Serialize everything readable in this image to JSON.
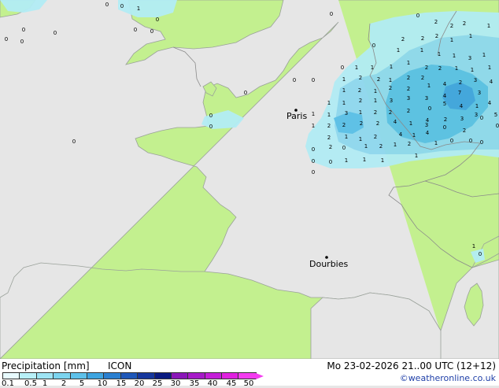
{
  "map": {
    "colors": {
      "sea": "#e6e6e6",
      "land": "#c3f08f",
      "coast": "#9aa19a",
      "border": "#8a8a8a",
      "rain_light": "#b2ecf4",
      "rain_mid": "#8ed8ee",
      "rain_heavy": "#58c0e6"
    },
    "cities": [
      {
        "name": "Paris",
        "dot": [
          376,
          140
        ],
        "label": [
          364,
          151
        ]
      },
      {
        "name": "Dourbies",
        "dot": [
          415,
          327
        ],
        "label": [
          393,
          339
        ]
      }
    ],
    "precip_values": [
      [
        "1",
        176,
        13
      ],
      [
        "0",
        136,
        8
      ],
      [
        "0",
        155,
        10
      ],
      [
        "0",
        30,
        40
      ],
      [
        "0",
        8,
        52
      ],
      [
        "0",
        28,
        55
      ],
      [
        "0",
        70,
        44
      ],
      [
        "0",
        172,
        40
      ],
      [
        "0",
        193,
        42
      ],
      [
        "0",
        200,
        27
      ],
      [
        "0",
        312,
        120
      ],
      [
        "0",
        268,
        149
      ],
      [
        "0",
        268,
        163
      ],
      [
        "0",
        94,
        182
      ],
      [
        "0",
        374,
        104
      ],
      [
        "0",
        398,
        104
      ],
      [
        "0",
        421,
        20
      ],
      [
        "2",
        512,
        52
      ],
      [
        "2",
        537,
        51
      ],
      [
        "2",
        555,
        48
      ],
      [
        "1",
        574,
        53
      ],
      [
        "1",
        598,
        48
      ],
      [
        "2",
        590,
        32
      ],
      [
        "2",
        574,
        35
      ],
      [
        "2",
        554,
        30
      ],
      [
        "0",
        531,
        22
      ],
      [
        "1",
        621,
        35
      ],
      [
        "0",
        475,
        60
      ],
      [
        "1",
        506,
        66
      ],
      [
        "1",
        536,
        66
      ],
      [
        "1",
        558,
        71
      ],
      [
        "1",
        577,
        73
      ],
      [
        "3",
        597,
        76
      ],
      [
        "1",
        519,
        82
      ],
      [
        "1",
        497,
        87
      ],
      [
        "2",
        542,
        88
      ],
      [
        "2",
        559,
        89
      ],
      [
        "1",
        580,
        89
      ],
      [
        "1",
        600,
        91
      ],
      [
        "1",
        622,
        88
      ],
      [
        "1",
        615,
        72
      ],
      [
        "0",
        435,
        88
      ],
      [
        "1",
        453,
        88
      ],
      [
        "1",
        473,
        88
      ],
      [
        "2",
        481,
        103
      ],
      [
        "1",
        496,
        104
      ],
      [
        "2",
        458,
        101
      ],
      [
        "1",
        437,
        103
      ],
      [
        "2",
        519,
        101
      ],
      [
        "2",
        537,
        101
      ],
      [
        "1",
        545,
        111
      ],
      [
        "4",
        565,
        109
      ],
      [
        "2",
        585,
        107
      ],
      [
        "3",
        604,
        104
      ],
      [
        "4",
        624,
        106
      ],
      [
        "1",
        437,
        117
      ],
      [
        "2",
        457,
        117
      ],
      [
        "1",
        477,
        118
      ],
      [
        "2",
        496,
        114
      ],
      [
        "2",
        519,
        115
      ],
      [
        "7",
        584,
        120
      ],
      [
        "4",
        565,
        124
      ],
      [
        "3",
        609,
        120
      ],
      [
        "4",
        622,
        133
      ],
      [
        "3",
        542,
        127
      ],
      [
        "1",
        418,
        133
      ],
      [
        "1",
        437,
        133
      ],
      [
        "2",
        458,
        130
      ],
      [
        "1",
        477,
        130
      ],
      [
        "3",
        497,
        130
      ],
      [
        "3",
        519,
        127
      ],
      [
        "0",
        546,
        140
      ],
      [
        "4",
        586,
        137
      ],
      [
        "1",
        606,
        137
      ],
      [
        "5",
        565,
        134
      ],
      [
        "1",
        398,
        147
      ],
      [
        "1",
        418,
        148
      ],
      [
        "3",
        440,
        146
      ],
      [
        "1",
        458,
        145
      ],
      [
        "2",
        477,
        145
      ],
      [
        "2",
        496,
        145
      ],
      [
        "2",
        519,
        143
      ],
      [
        "4",
        543,
        155
      ],
      [
        "2",
        566,
        154
      ],
      [
        "3",
        587,
        153
      ],
      [
        "3",
        605,
        148
      ],
      [
        "5",
        630,
        148
      ],
      [
        "1",
        398,
        162
      ],
      [
        "2",
        418,
        162
      ],
      [
        "2",
        437,
        161
      ],
      [
        "2",
        459,
        159
      ],
      [
        "2",
        480,
        159
      ],
      [
        "4",
        502,
        157
      ],
      [
        "1",
        522,
        159
      ],
      [
        "3",
        542,
        161
      ],
      [
        "0",
        565,
        164
      ],
      [
        "0",
        612,
        152
      ],
      [
        "0",
        632,
        162
      ],
      [
        "2",
        418,
        177
      ],
      [
        "1",
        440,
        176
      ],
      [
        "1",
        458,
        179
      ],
      [
        "2",
        477,
        176
      ],
      [
        "4",
        509,
        173
      ],
      [
        "1",
        526,
        174
      ],
      [
        "4",
        543,
        171
      ],
      [
        "1",
        554,
        184
      ],
      [
        "0",
        574,
        181
      ],
      [
        "2",
        590,
        168
      ],
      [
        "0",
        598,
        181
      ],
      [
        "0",
        398,
        192
      ],
      [
        "2",
        420,
        189
      ],
      [
        "0",
        437,
        190
      ],
      [
        "1",
        465,
        188
      ],
      [
        "2",
        484,
        188
      ],
      [
        "1",
        502,
        186
      ],
      [
        "2",
        520,
        185
      ],
      [
        "1",
        529,
        200
      ],
      [
        "0",
        612,
        183
      ],
      [
        "0",
        398,
        207
      ],
      [
        "0",
        420,
        208
      ],
      [
        "1",
        440,
        206
      ],
      [
        "1",
        463,
        205
      ],
      [
        "1",
        486,
        206
      ],
      [
        "0",
        398,
        221
      ],
      [
        "1",
        602,
        315
      ],
      [
        "0",
        610,
        325
      ]
    ]
  },
  "footer": {
    "legend_title": "Precipitation [mm]",
    "model": "ICON",
    "run_time": "Mo 23-02-2026 21..00 UTC (12+12)",
    "credit": "©weatheronline.co.uk",
    "scale_colors": [
      "#e8fbff",
      "#b8f0f8",
      "#9ee4f4",
      "#7cd4ef",
      "#5ec1ea",
      "#3ea4e0",
      "#2a7fd0",
      "#1e57b8",
      "#16379c",
      "#0a1a80",
      "#8a17b8",
      "#a61ac8",
      "#c41ed8",
      "#e020e0",
      "#f43cf0"
    ],
    "scale_labels": [
      "0.1",
      "0.5",
      "1",
      "2",
      "5",
      "10",
      "15",
      "20",
      "25",
      "30",
      "35",
      "40",
      "45",
      "50"
    ]
  }
}
